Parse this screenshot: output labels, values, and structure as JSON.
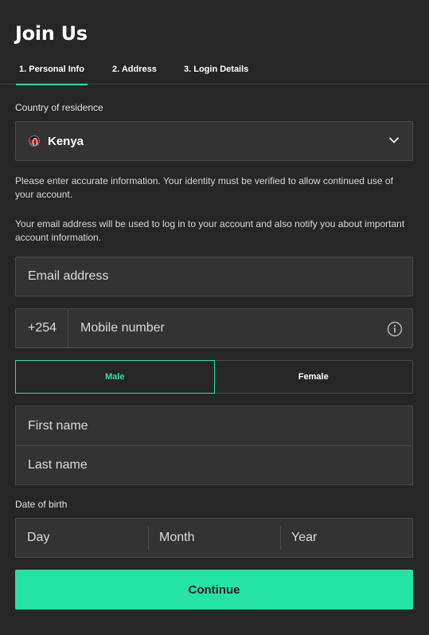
{
  "header": {
    "title": "Join Us"
  },
  "tabs": [
    {
      "label": "1. Personal Info",
      "active": true
    },
    {
      "label": "2. Address",
      "active": false
    },
    {
      "label": "3. Login Details",
      "active": false
    }
  ],
  "country": {
    "label": "Country of residence",
    "value": "Kenya",
    "flag_icon": "kenya-flag-icon"
  },
  "notices": {
    "identity": "Please enter accurate information. Your identity must be verified to allow continued use of your account.",
    "email": "Your email address will be used to log in to your account and also notify you about important account information."
  },
  "email": {
    "placeholder": "Email address"
  },
  "mobile": {
    "prefix": "+254",
    "placeholder": "Mobile number",
    "icon": "info-icon"
  },
  "gender": {
    "male": "Male",
    "female": "Female",
    "selected": "Male"
  },
  "name": {
    "first_placeholder": "First name",
    "last_placeholder": "Last name"
  },
  "dob": {
    "label": "Date of birth",
    "day": "Day",
    "month": "Month",
    "year": "Year"
  },
  "actions": {
    "continue": "Continue"
  },
  "colors": {
    "accent": "#25e2a5",
    "background": "#262626",
    "field": "#333333"
  }
}
